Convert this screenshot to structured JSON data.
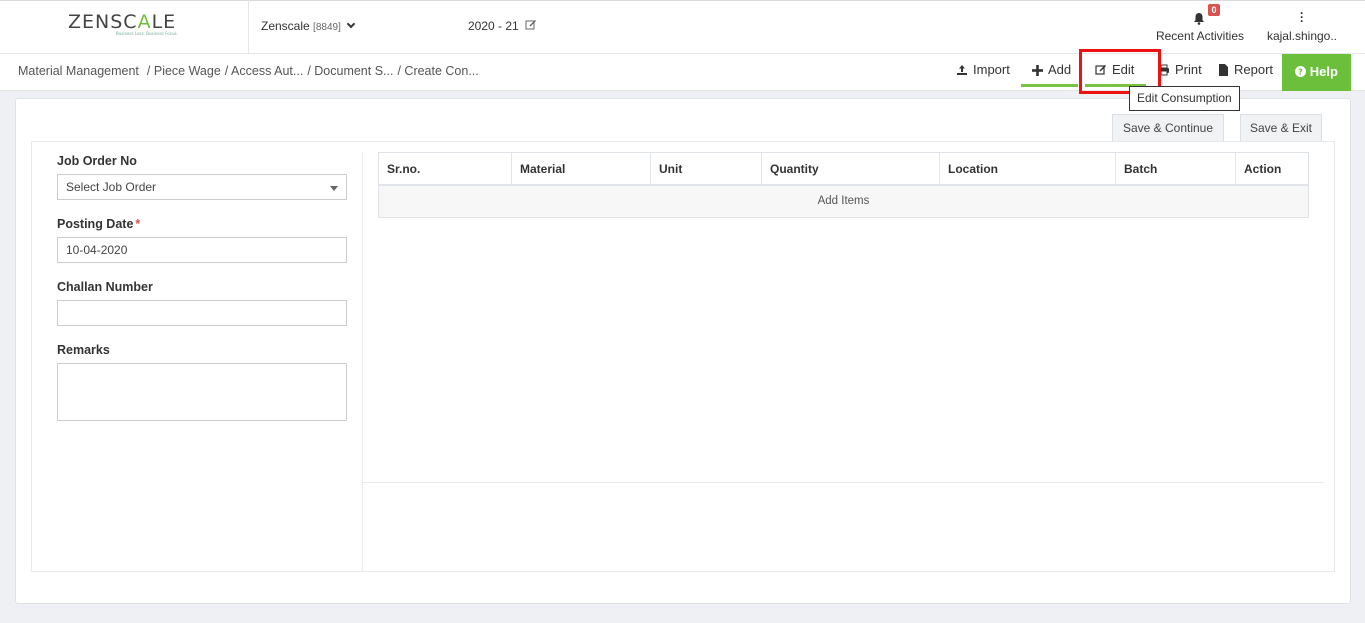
{
  "header": {
    "logo_main": "ZENSC",
    "logo_accent": "A",
    "logo_end": "LE",
    "tagline": "Business Less. Business Focus.",
    "company_name": "Zenscale",
    "company_code": "[8849]",
    "fiscal_year": "2020 - 21",
    "notifications_count": "0",
    "recent_activities_label": "Recent Activities",
    "user_name": "kajal.shingo.."
  },
  "breadcrumb": {
    "items": [
      "Material Management",
      "/ Piece Wage",
      "/ Access Aut...",
      "/ Document S...",
      "/ Create Con..."
    ]
  },
  "toolbar": {
    "import_label": "Import",
    "add_label": "Add",
    "edit_label": "Edit",
    "print_label": "Print",
    "report_label": "Report",
    "help_label": "Help",
    "edit_tooltip": "Edit Consumption"
  },
  "actions": {
    "save_continue": "Save & Continue",
    "save_exit": "Save & Exit"
  },
  "form": {
    "job_order_label": "Job Order No",
    "job_order_value": "Select Job Order",
    "posting_date_label": "Posting Date",
    "posting_date_required": "*",
    "posting_date_value": "10-04-2020",
    "challan_label": "Challan Number",
    "challan_value": "",
    "remarks_label": "Remarks",
    "remarks_value": ""
  },
  "table": {
    "columns": [
      "Sr.no.",
      "Material",
      "Unit",
      "Quantity",
      "Location",
      "Batch",
      "Action"
    ],
    "add_items_label": "Add Items"
  },
  "colors": {
    "accent_green": "#6cbf3b",
    "highlight_red": "#e11111",
    "badge_red": "#d9534f"
  }
}
